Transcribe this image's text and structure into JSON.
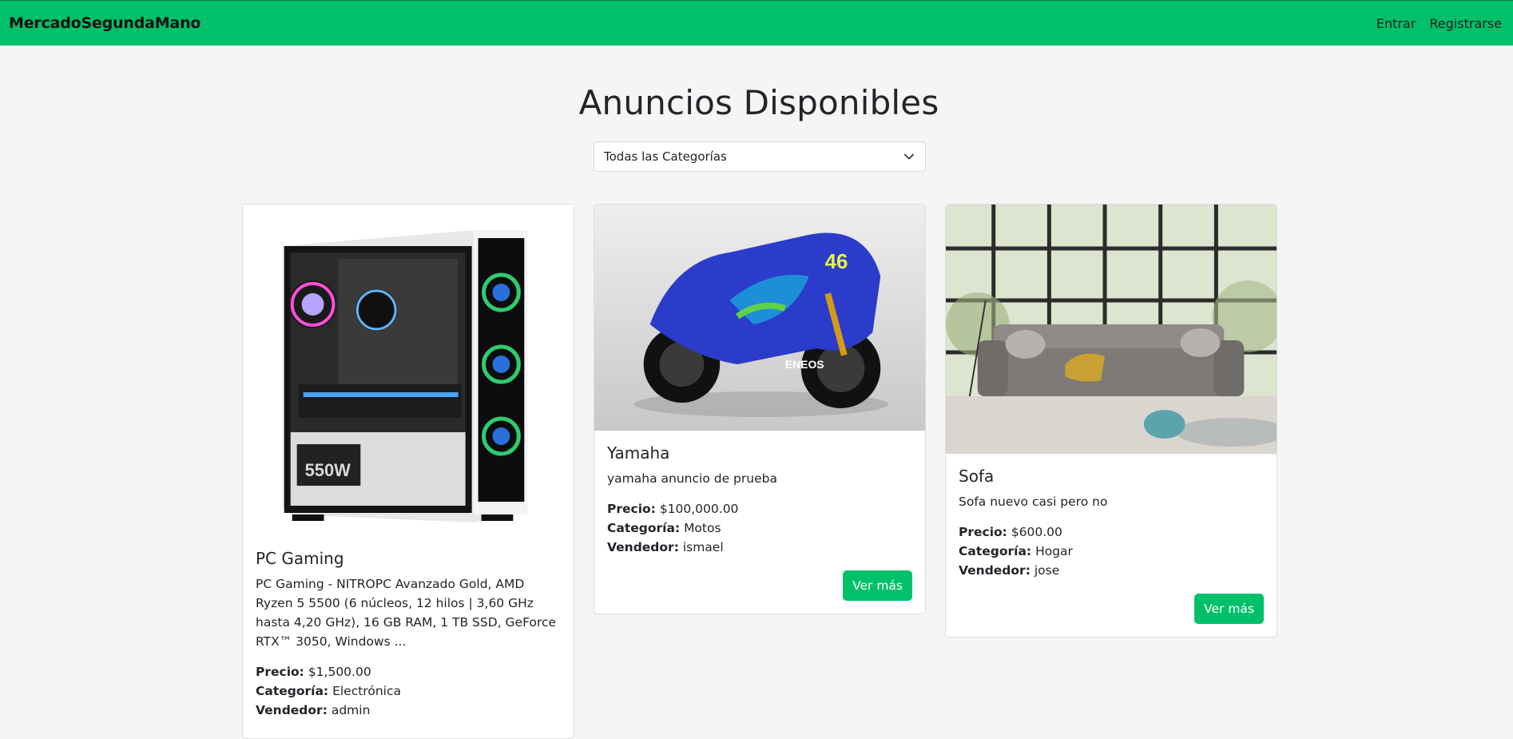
{
  "nav": {
    "brand": "MercadoSegundaMano",
    "links": [
      "Entrar",
      "Registrarse"
    ]
  },
  "page": {
    "title": "Anuncios Disponibles",
    "category_select": {
      "selected": "Todas las Categorías",
      "icon": "chevron-down-icon"
    }
  },
  "labels": {
    "price": "Precio:",
    "category": "Categoría:",
    "seller": "Vendedor:",
    "button": "Ver más"
  },
  "listings": [
    {
      "title": "PC Gaming",
      "description": "PC Gaming - NITROPC Avanzado Gold, AMD Ryzen 5 5500 (6 núcleos, 12 hilos | 3,60 GHz hasta 4,20 GHz), 16 GB RAM, 1 TB SSD, GeForce RTX™ 3050, Windows ...",
      "price": "$1,500.00",
      "category": "Electrónica",
      "seller": "admin",
      "image": "pc-case-image",
      "image_text": "550W"
    },
    {
      "title": "Yamaha",
      "description": "yamaha anuncio de prueba",
      "price": "$100,000.00",
      "category": "Motos",
      "seller": "ismael",
      "image": "motorcycle-image",
      "image_text": [
        "46",
        "ENEOS"
      ]
    },
    {
      "title": "Sofa",
      "description": "Sofa nuevo casi pero no",
      "price": "$600.00",
      "category": "Hogar",
      "seller": "jose",
      "image": "sofa-image"
    }
  ],
  "colors": {
    "accent": "#00c16a",
    "background": "#f5f5f5"
  }
}
